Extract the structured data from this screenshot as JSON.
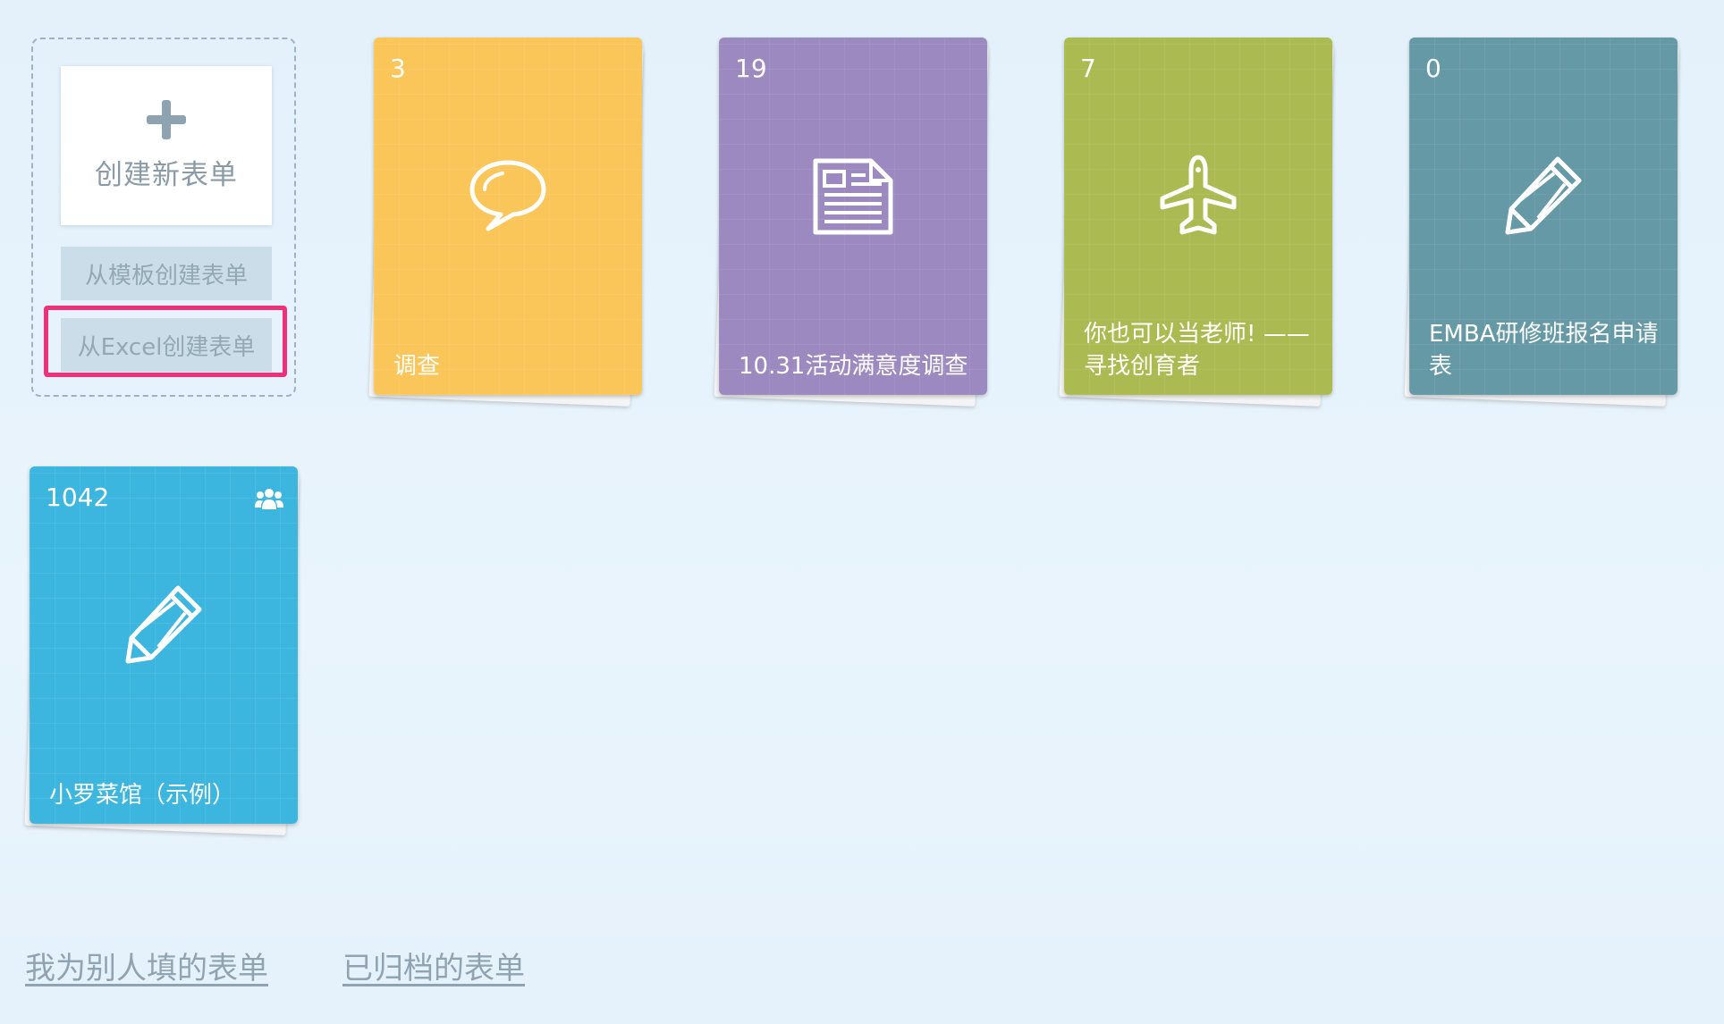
{
  "create_panel": {
    "new_form_label": "创建新表单",
    "from_template_label": "从模板创建表单",
    "from_excel_label": "从Excel创建表单"
  },
  "forms": [
    {
      "count": "3",
      "title": "调查",
      "icon": "speech-bubble-icon",
      "color": "#fbc659"
    },
    {
      "count": "19",
      "title": "10.31活动满意度调查",
      "icon": "newspaper-icon",
      "color": "#9b89bf"
    },
    {
      "count": "7",
      "title": "你也可以当老师! —— 寻找创育者",
      "icon": "airplane-icon",
      "color": "#abbb51"
    },
    {
      "count": "0",
      "title": "EMBA研修班报名申请表",
      "icon": "pencil-icon",
      "color": "#6699a6"
    },
    {
      "count": "1042",
      "title": "小罗菜馆（示例）",
      "icon": "pencil-icon",
      "color": "#3db6df",
      "shared": true
    }
  ],
  "footer": {
    "filled_for_others": "我为别人填的表单",
    "archived": "已归档的表单"
  }
}
